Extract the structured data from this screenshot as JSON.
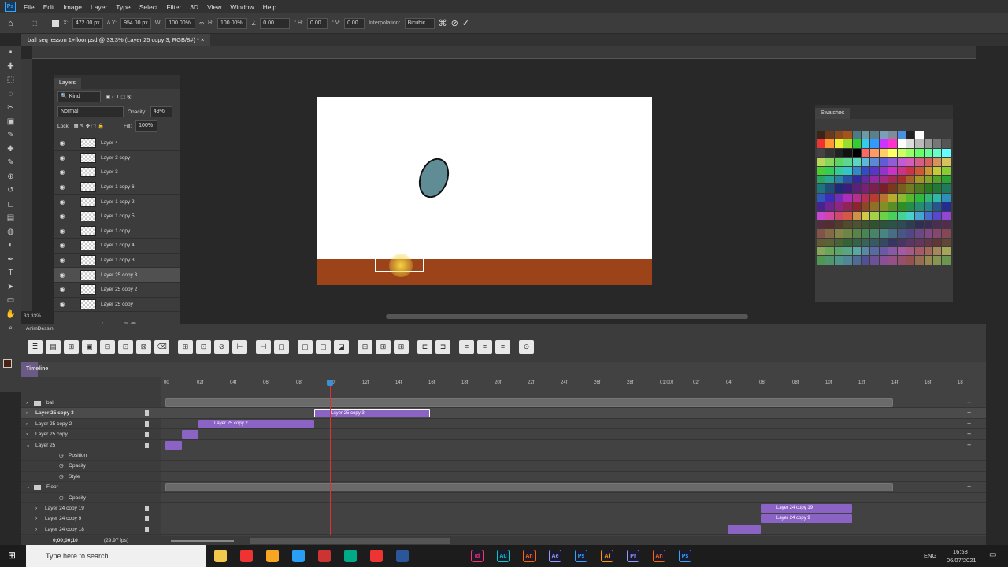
{
  "menu": [
    "File",
    "Edit",
    "Image",
    "Layer",
    "Type",
    "Select",
    "Filter",
    "3D",
    "View",
    "Window",
    "Help"
  ],
  "options": {
    "x": "472.00 px",
    "y": "954.00 px",
    "w": "100.00%",
    "h": "100.00%",
    "angle": "0.00",
    "hskew": "0.00",
    "vskew": "0.00",
    "interpolation_label": "Interpolation:",
    "interpolation": "Bicubic"
  },
  "document_tab": "ball seq lesson 1+floor.psd @ 33.3% (Layer 25 copy 3, RGB/8#) *",
  "zoom_level": "33.33%",
  "layers": {
    "title": "Layers",
    "filter": "Kind",
    "blend": "Normal",
    "opacity_label": "Opacity:",
    "opacity": "49%",
    "lock_label": "Lock:",
    "fill_label": "Fill:",
    "fill": "100%",
    "items": [
      {
        "name": "Layer 4"
      },
      {
        "name": "Layer 3 copy"
      },
      {
        "name": "Layer 3"
      },
      {
        "name": "Layer 1 copy 6"
      },
      {
        "name": "Layer 1 copy 2"
      },
      {
        "name": "Layer 1 copy 5"
      },
      {
        "name": "Layer 1 copy"
      },
      {
        "name": "Layer 1 copy 4"
      },
      {
        "name": "Layer 1 copy 3"
      },
      {
        "name": "Layer 25 copy 3",
        "selected": true
      },
      {
        "name": "Layer 25 copy 2"
      },
      {
        "name": "Layer 25 copy"
      }
    ]
  },
  "swatches": {
    "title": "Swatches"
  },
  "anim_panel": {
    "title": "AnimDessin"
  },
  "timeline": {
    "title": "Timeline",
    "timecode": "0;00;00;10",
    "fps": "(29.97 fps)",
    "ticks": [
      "00",
      "02f",
      "04f",
      "06f",
      "08f",
      "10f",
      "12f",
      "14f",
      "16f",
      "18f",
      "20f",
      "22f",
      "24f",
      "26f",
      "28f",
      "01:00f",
      "02f",
      "04f",
      "06f",
      "08f",
      "10f",
      "12f",
      "14f",
      "16f",
      "18"
    ],
    "tracks": [
      {
        "label": "ball",
        "type": "group"
      },
      {
        "label": "Layer 25 copy 3",
        "type": "layer",
        "bold": true
      },
      {
        "label": "Layer 25 copy 2",
        "type": "layer"
      },
      {
        "label": "Layer 25 copy",
        "type": "layer"
      },
      {
        "label": "Layer 25",
        "type": "layer",
        "open": true
      },
      {
        "label": "Position",
        "type": "prop"
      },
      {
        "label": "Opacity",
        "type": "prop"
      },
      {
        "label": "Style",
        "type": "prop"
      },
      {
        "label": "Floor",
        "type": "group",
        "open": true
      },
      {
        "label": "Opacity",
        "type": "prop"
      },
      {
        "label": "Layer 24 copy 19",
        "type": "sub"
      },
      {
        "label": "Layer 24 copy 9",
        "type": "sub"
      },
      {
        "label": "Layer 24 copy 18",
        "type": "sub"
      }
    ],
    "clip_labels": {
      "c3": "Layer 25 copy 3",
      "c2": "Layer 25 copy 2",
      "l19": "Layer 24 copy 19",
      "l9": "Layer 24 copy 9"
    }
  },
  "taskbar": {
    "search_placeholder": "Type here to search",
    "lang": "ENG",
    "time": "16:58",
    "date": "06/07/2021",
    "apps": [
      "Id",
      "Au",
      "An",
      "Ae",
      "Ps",
      "Ai",
      "Pr",
      "An",
      "Ps"
    ]
  },
  "colors": {
    "floor": "#9c4319",
    "ball": "#5f8c95",
    "clip": "#8a63c4",
    "playhead": "#e03030"
  }
}
